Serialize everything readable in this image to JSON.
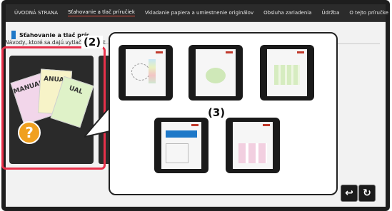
{
  "nav": {
    "items": [
      {
        "label": "ÚVODNÁ STRANA",
        "active": false
      },
      {
        "label": "Sťahovanie a tlač príručiek",
        "active": true
      },
      {
        "label": "Vkladanie papiera a umiestnenie originálov",
        "active": false
      },
      {
        "label": "Obsluha zariadenia",
        "active": false
      },
      {
        "label": "Údržba",
        "active": false
      },
      {
        "label": "O tejto príručke",
        "active": false
      }
    ]
  },
  "section": {
    "title": "Sťahovanie a tlač prír"
  },
  "description": "Návody, ktoré sa dajú vytlačiť",
  "desc_truncated": "St",
  "card": {
    "sheets": [
      "MANUAL",
      "ANUAL",
      "UAL"
    ],
    "question_mark": "?"
  },
  "callouts": {
    "label_2": "(2)",
    "label_3": "(3)"
  },
  "thumbnails": [
    {
      "name": "manual-thumb-1"
    },
    {
      "name": "manual-thumb-2"
    },
    {
      "name": "manual-thumb-3"
    },
    {
      "name": "manual-thumb-4"
    },
    {
      "name": "manual-thumb-5"
    }
  ],
  "footer": {
    "back_icon": "back-icon",
    "refresh_icon": "refresh-icon"
  },
  "colors": {
    "accent_red": "#e8304a",
    "brand_blue": "#1e78c8",
    "sharp_red": "#c0392b"
  }
}
